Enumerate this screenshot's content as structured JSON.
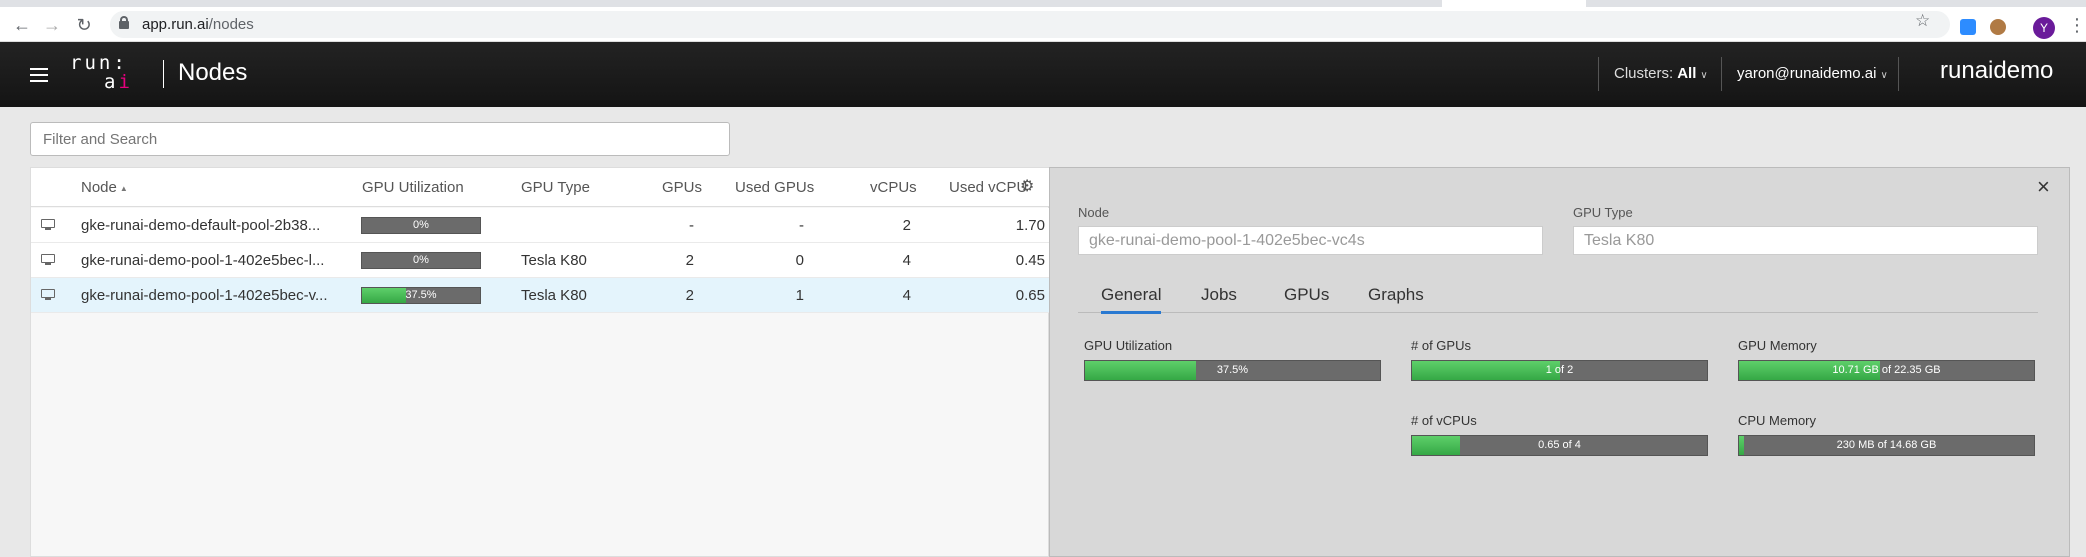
{
  "browser": {
    "url_host": "app.run.ai",
    "url_path": "/nodes",
    "profile_initial": "Y"
  },
  "header": {
    "logo_line1": "run:",
    "logo_line2_a": "a",
    "logo_line2_b": "i",
    "page_title": "Nodes",
    "clusters_label": "Clusters:",
    "clusters_value": "All",
    "user_email": "yaron@runaidemo.ai",
    "tenant": "runaidemo"
  },
  "search": {
    "placeholder": "Filter and Search"
  },
  "table": {
    "columns": {
      "node": "Node",
      "gpu_utilization": "GPU Utilization",
      "gpu_type": "GPU Type",
      "gpus": "GPUs",
      "used_gpus": "Used GPUs",
      "vcpus": "vCPUs",
      "used_vcpu": "Used vCPU"
    },
    "rows": [
      {
        "node": "gke-runai-demo-default-pool-2b38...",
        "gpu_util_label": "0%",
        "gpu_util": 0,
        "gpu_type": "",
        "gpus": "-",
        "used_gpus": "-",
        "vcpus": "2",
        "used_vcpu": "1.70",
        "selected": false
      },
      {
        "node": "gke-runai-demo-pool-1-402e5bec-l...",
        "gpu_util_label": "0%",
        "gpu_util": 0,
        "gpu_type": "Tesla K80",
        "gpus": "2",
        "used_gpus": "0",
        "vcpus": "4",
        "used_vcpu": "0.45",
        "selected": false
      },
      {
        "node": "gke-runai-demo-pool-1-402e5bec-v...",
        "gpu_util_label": "37.5%",
        "gpu_util": 37.5,
        "gpu_type": "Tesla K80",
        "gpus": "2",
        "used_gpus": "1",
        "vcpus": "4",
        "used_vcpu": "0.65",
        "selected": true
      }
    ]
  },
  "details": {
    "node_label": "Node",
    "node_value": "gke-runai-demo-pool-1-402e5bec-vc4s",
    "gpu_type_label": "GPU Type",
    "gpu_type_value": "Tesla K80",
    "tabs": [
      "General",
      "Jobs",
      "GPUs",
      "Graphs"
    ],
    "metrics": {
      "gpu_utilization": {
        "label": "GPU Utilization",
        "text": "37.5%",
        "fraction": 0.375
      },
      "num_gpus": {
        "label": "# of GPUs",
        "text": "1 of 2",
        "fraction": 0.5
      },
      "gpu_memory": {
        "label": "GPU Memory",
        "text": "10.71 GB of 22.35 GB",
        "fraction": 0.479
      },
      "num_vcpus": {
        "label": "# of vCPUs",
        "text": "0.65 of 4",
        "fraction": 0.1625
      },
      "cpu_memory": {
        "label": "CPU Memory",
        "text": "230 MB of 14.68 GB",
        "fraction": 0.016
      }
    }
  }
}
